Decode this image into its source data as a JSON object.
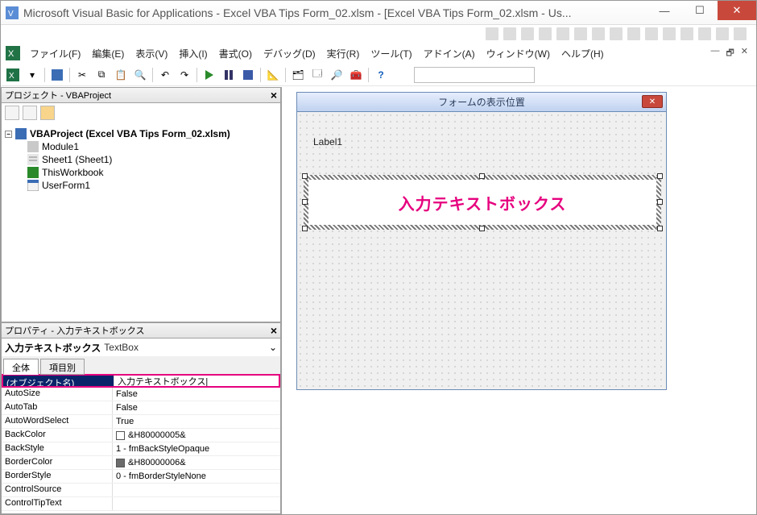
{
  "window": {
    "title": "Microsoft Visual Basic for Applications - Excel VBA Tips Form_02.xlsm - [Excel VBA Tips Form_02.xlsm - Us..."
  },
  "menu": {
    "file": "ファイル(F)",
    "edit": "編集(E)",
    "view": "表示(V)",
    "insert": "挿入(I)",
    "format": "書式(O)",
    "debug": "デバッグ(D)",
    "run": "実行(R)",
    "tools": "ツール(T)",
    "addins": "アドイン(A)",
    "window": "ウィンドウ(W)",
    "help": "ヘルプ(H)"
  },
  "project": {
    "title": "プロジェクト - VBAProject",
    "root": "VBAProject (Excel VBA Tips Form_02.xlsm)",
    "items": [
      "Module1",
      "Sheet1 (Sheet1)",
      "ThisWorkbook",
      "UserForm1"
    ]
  },
  "properties": {
    "title": "プロパティ - 入力テキストボックス",
    "object_name": "入力テキストボックス",
    "object_type": "TextBox",
    "tab_all": "全体",
    "tab_cat": "項目別",
    "rows": [
      {
        "name": "(オブジェクト名)",
        "value": "入力テキストボックス|",
        "selected": true
      },
      {
        "name": "AutoSize",
        "value": "False"
      },
      {
        "name": "AutoTab",
        "value": "False"
      },
      {
        "name": "AutoWordSelect",
        "value": "True"
      },
      {
        "name": "BackColor",
        "value": "&H80000005&",
        "swatch": "#ffffff"
      },
      {
        "name": "BackStyle",
        "value": "1 - fmBackStyleOpaque"
      },
      {
        "name": "BorderColor",
        "value": "&H80000006&",
        "swatch": "#6b6b6b"
      },
      {
        "name": "BorderStyle",
        "value": "0 - fmBorderStyleNone"
      },
      {
        "name": "ControlSource",
        "value": ""
      },
      {
        "name": "ControlTipText",
        "value": ""
      }
    ]
  },
  "form": {
    "caption": "フォームの表示位置",
    "label1": "Label1",
    "textbox_text": "入力テキストボックス"
  }
}
